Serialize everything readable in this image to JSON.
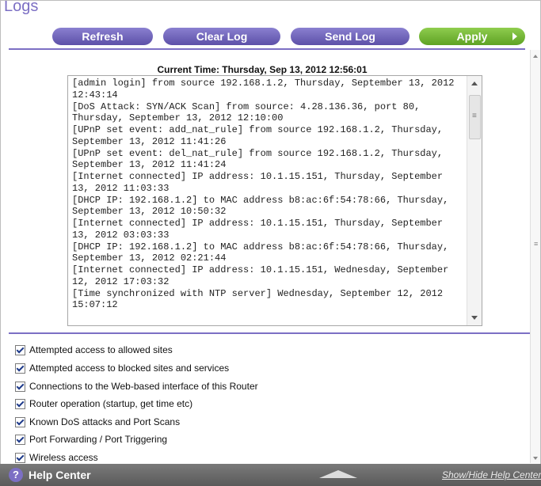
{
  "page": {
    "title": "Logs"
  },
  "toolbar": {
    "refresh_label": "Refresh",
    "clear_log_label": "Clear Log",
    "send_log_label": "Send Log",
    "apply_label": "Apply"
  },
  "log": {
    "current_time": "Current Time: Thursday, Sep 13, 2012 12:56:01",
    "text": "[admin login] from source 192.168.1.2, Thursday, September 13, 2012 12:43:14\n[DoS Attack: SYN/ACK Scan] from source: 4.28.136.36, port 80, Thursday, September 13, 2012 12:10:00\n[UPnP set event: add_nat_rule] from source 192.168.1.2, Thursday, September 13, 2012 11:41:26\n[UPnP set event: del_nat_rule] from source 192.168.1.2, Thursday, September 13, 2012 11:41:24\n[Internet connected] IP address: 10.1.15.151, Thursday, September 13, 2012 11:03:33\n[DHCP IP: 192.168.1.2] to MAC address b8:ac:6f:54:78:66, Thursday, September 13, 2012 10:50:32\n[Internet connected] IP address: 10.1.15.151, Thursday, September 13, 2012 03:03:33\n[DHCP IP: 192.168.1.2] to MAC address b8:ac:6f:54:78:66, Thursday, September 13, 2012 02:21:44\n[Internet connected] IP address: 10.1.15.151, Wednesday, September 12, 2012 17:03:32\n[Time synchronized with NTP server] Wednesday, September 12, 2012 15:07:12"
  },
  "options": [
    {
      "label": "Attempted access to allowed sites",
      "checked": true
    },
    {
      "label": "Attempted access to blocked sites and services",
      "checked": true
    },
    {
      "label": "Connections to the Web-based interface of this Router",
      "checked": true
    },
    {
      "label": "Router operation (startup, get time etc)",
      "checked": true
    },
    {
      "label": "Known DoS attacks and Port Scans",
      "checked": true
    },
    {
      "label": "Port Forwarding / Port Triggering",
      "checked": true
    },
    {
      "label": "Wireless access",
      "checked": true
    }
  ],
  "help": {
    "label": "Help Center",
    "toggle_label": "Show/Hide Help Center"
  },
  "colors": {
    "accent_purple": "#7c6fc4",
    "apply_green": "#6cb32f",
    "helpbar_gray": "#666666"
  }
}
